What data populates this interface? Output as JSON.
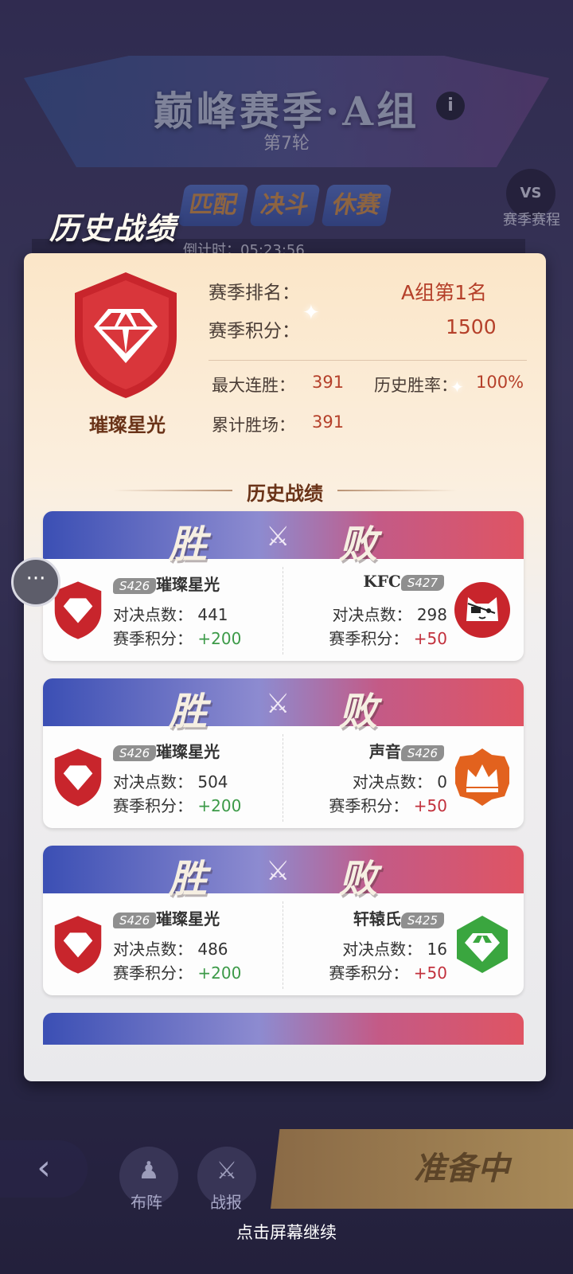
{
  "background": {
    "title": "巅峰赛季·A组",
    "round": "第7轮",
    "info_icon": "i",
    "phases": [
      "匹配",
      "决斗",
      "休赛"
    ],
    "schedule_label": "赛季赛程",
    "timer_text": "倒计时：05:23:56"
  },
  "panel": {
    "title": "历史战绩",
    "player_badge_name": "璀璨星光",
    "stats": {
      "rank_label": "赛季排名：",
      "rank_value": "A组第1名",
      "points_label": "赛季积分：",
      "points_value": "1500",
      "max_streak_label": "最大连胜：",
      "max_streak_value": "391",
      "win_rate_label": "历史胜率：",
      "win_rate_value": "100%",
      "total_wins_label": "累计胜场：",
      "total_wins_value": "391"
    },
    "section_title": "历史战绩",
    "matches": [
      {
        "win_label": "胜",
        "lose_label": "败",
        "left": {
          "server": "S426",
          "name": "璀璨星光",
          "score_label": "对决点数：",
          "score": "441",
          "points_label": "赛季积分：",
          "points": "+200"
        },
        "right": {
          "server": "S427",
          "name": "KFC",
          "score_label": "对决点数：",
          "score": "298",
          "points_label": "赛季积分：",
          "points": "+50",
          "avatar": "pirate-cat"
        }
      },
      {
        "win_label": "胜",
        "lose_label": "败",
        "left": {
          "server": "S426",
          "name": "璀璨星光",
          "score_label": "对决点数：",
          "score": "504",
          "points_label": "赛季积分：",
          "points": "+200"
        },
        "right": {
          "server": "S426",
          "name": "声音",
          "score_label": "对决点数：",
          "score": "0",
          "points_label": "赛季积分：",
          "points": "+50",
          "avatar": "crown"
        }
      },
      {
        "win_label": "胜",
        "lose_label": "败",
        "left": {
          "server": "S426",
          "name": "璀璨星光",
          "score_label": "对决点数：",
          "score": "486",
          "points_label": "赛季积分：",
          "points": "+200"
        },
        "right": {
          "server": "S425",
          "name": "轩辕氏",
          "score_label": "对决点数：",
          "score": "16",
          "points_label": "赛季积分：",
          "points": "+50",
          "avatar": "green-diamond"
        }
      }
    ]
  },
  "bottom": {
    "formation_label": "布阵",
    "report_label": "战报",
    "ready_label": "准备中",
    "continue_hint": "点击屏幕继续"
  },
  "colors": {
    "win_green": "#3c9a48",
    "lose_red": "#c2313d",
    "title_brown": "#6a3318"
  }
}
